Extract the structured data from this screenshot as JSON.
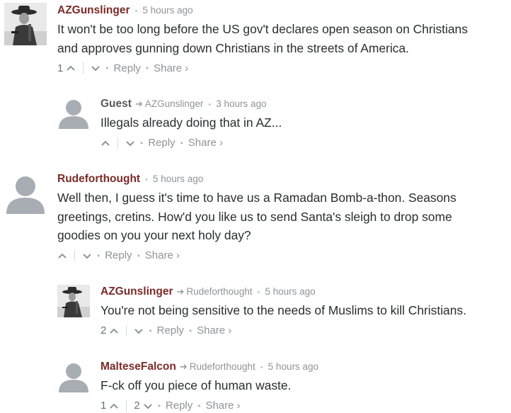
{
  "comments": [
    {
      "author": "AZGunslinger",
      "reply_to": "",
      "time": "5 hours ago",
      "avatar": "gunslinger-avatar",
      "text_lines": [
        "It won't be too long before the US gov't declares open season on Christians",
        "and approves gunning down Christians in the streets of America."
      ],
      "upvotes": "1",
      "downvotes": "",
      "reply_label": "Reply",
      "share_label": "Share ›"
    },
    {
      "author": "Guest",
      "reply_to": "AZGunslinger",
      "time": "3 hours ago",
      "avatar": "default-avatar",
      "text_lines": [
        "Illegals already doing that in AZ..."
      ],
      "upvotes": "",
      "downvotes": "",
      "reply_label": "Reply",
      "share_label": "Share ›"
    },
    {
      "author": "Rudeforthought",
      "reply_to": "",
      "time": "5 hours ago",
      "avatar": "default-avatar",
      "text_lines": [
        "Well then, I guess it's time to have us a Ramadan Bomb-a-thon. Seasons",
        "greetings, cretins. How'd you like us to send Santa's sleigh to drop some",
        "goodies on you your next holy day?"
      ],
      "upvotes": "",
      "downvotes": "",
      "reply_label": "Reply",
      "share_label": "Share ›"
    },
    {
      "author": "AZGunslinger",
      "reply_to": "Rudeforthought",
      "time": "5 hours ago",
      "avatar": "gunslinger-avatar",
      "text_lines": [
        "You're not being sensitive to the needs of Muslims to kill Christians."
      ],
      "upvotes": "2",
      "downvotes": "",
      "reply_label": "Reply",
      "share_label": "Share ›"
    },
    {
      "author": "MalteseFalcon",
      "reply_to": "Rudeforthought",
      "time": "5 hours ago",
      "avatar": "default-avatar",
      "text_lines": [
        "F-ck off you piece of human waste."
      ],
      "upvotes": "1",
      "downvotes": "2",
      "reply_label": "Reply",
      "share_label": "Share ›"
    }
  ],
  "separator_dot": "•"
}
